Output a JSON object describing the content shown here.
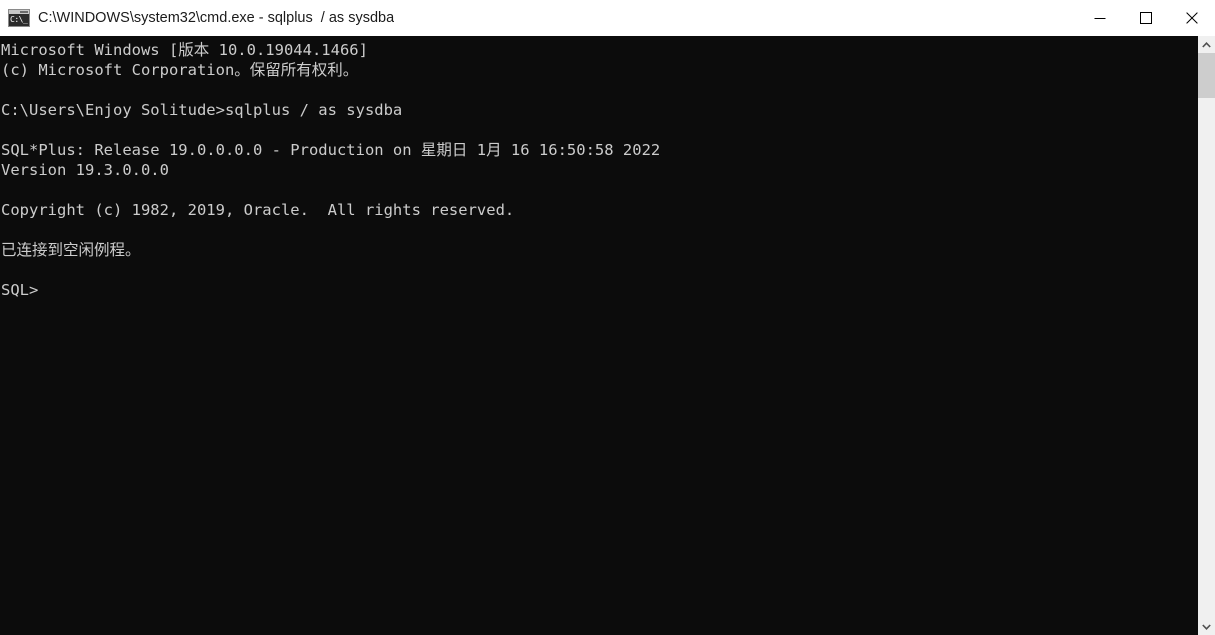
{
  "window": {
    "title": "C:\\WINDOWS\\system32\\cmd.exe - sqlplus  / as sysdba",
    "icon": "cmd-console-icon",
    "icon_glyph": "C:\\_",
    "background_color": "#0c0c0c",
    "titlebar_color": "#ffffff",
    "text_color": "#cccccc"
  },
  "titlebar_buttons": {
    "minimize": "minimize-icon",
    "maximize": "maximize-icon",
    "close": "close-icon"
  },
  "console": {
    "lines": [
      "Microsoft Windows [版本 10.0.19044.1466]",
      "(c) Microsoft Corporation。保留所有权利。",
      "",
      "C:\\Users\\Enjoy Solitude>sqlplus / as sysdba",
      "",
      "SQL*Plus: Release 19.0.0.0.0 - Production on 星期日 1月 16 16:50:58 2022",
      "Version 19.3.0.0.0",
      "",
      "Copyright (c) 1982, 2019, Oracle.  All rights reserved.",
      "",
      "已连接到空闲例程。",
      "",
      "SQL>"
    ]
  },
  "scrollbar": {
    "up_arrow": "chevron-up-icon",
    "down_arrow": "chevron-down-icon",
    "track_color": "#f0f0f0",
    "thumb_color": "#cdcdcd"
  }
}
